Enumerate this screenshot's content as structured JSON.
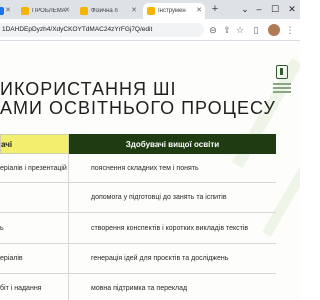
{
  "browser": {
    "tabs": [
      {
        "title": "",
        "active": false,
        "favicon_color": "#1a73e8"
      },
      {
        "title": "ПРОБЛЕМА",
        "active": false,
        "favicon_color": "#f4b400"
      },
      {
        "title": "Фізична п",
        "active": false,
        "favicon_color": "#f4b400"
      },
      {
        "title": "Інструмен",
        "active": true,
        "favicon_color": "#f4b400"
      }
    ],
    "new_tab_label": "+",
    "url": "1DAHDEpDyzh4/XdyCKOYTdMAC24zYrFGj7Q/edit"
  },
  "slide": {
    "title_line1": "ИКОРИСТАННЯ ШІ",
    "title_line2": "АМИ ОСВІТНЬОГО ПРОЦЕСУ",
    "table": {
      "header_left": "ачі",
      "header_right": "Здобувачі вищої освіти",
      "rows": [
        {
          "left": "еріалів і презентацій",
          "right": "пояснення складних тем і понять"
        },
        {
          "left": "",
          "right": "допомога у підготовці до занять та іспитів"
        },
        {
          "left": "ь",
          "right": "створення конспектів і коротких викладів текстів"
        },
        {
          "left": "еріалів",
          "right": "генерація ідей для проєктів та досліджень"
        },
        {
          "left": "біт і надання",
          "right": "мовна підтримка та переклад"
        }
      ]
    }
  },
  "colors": {
    "header_left_bg": "#f3ef6e",
    "header_right_bg": "#1f3b11",
    "logo_green": "#2e5e2a"
  }
}
